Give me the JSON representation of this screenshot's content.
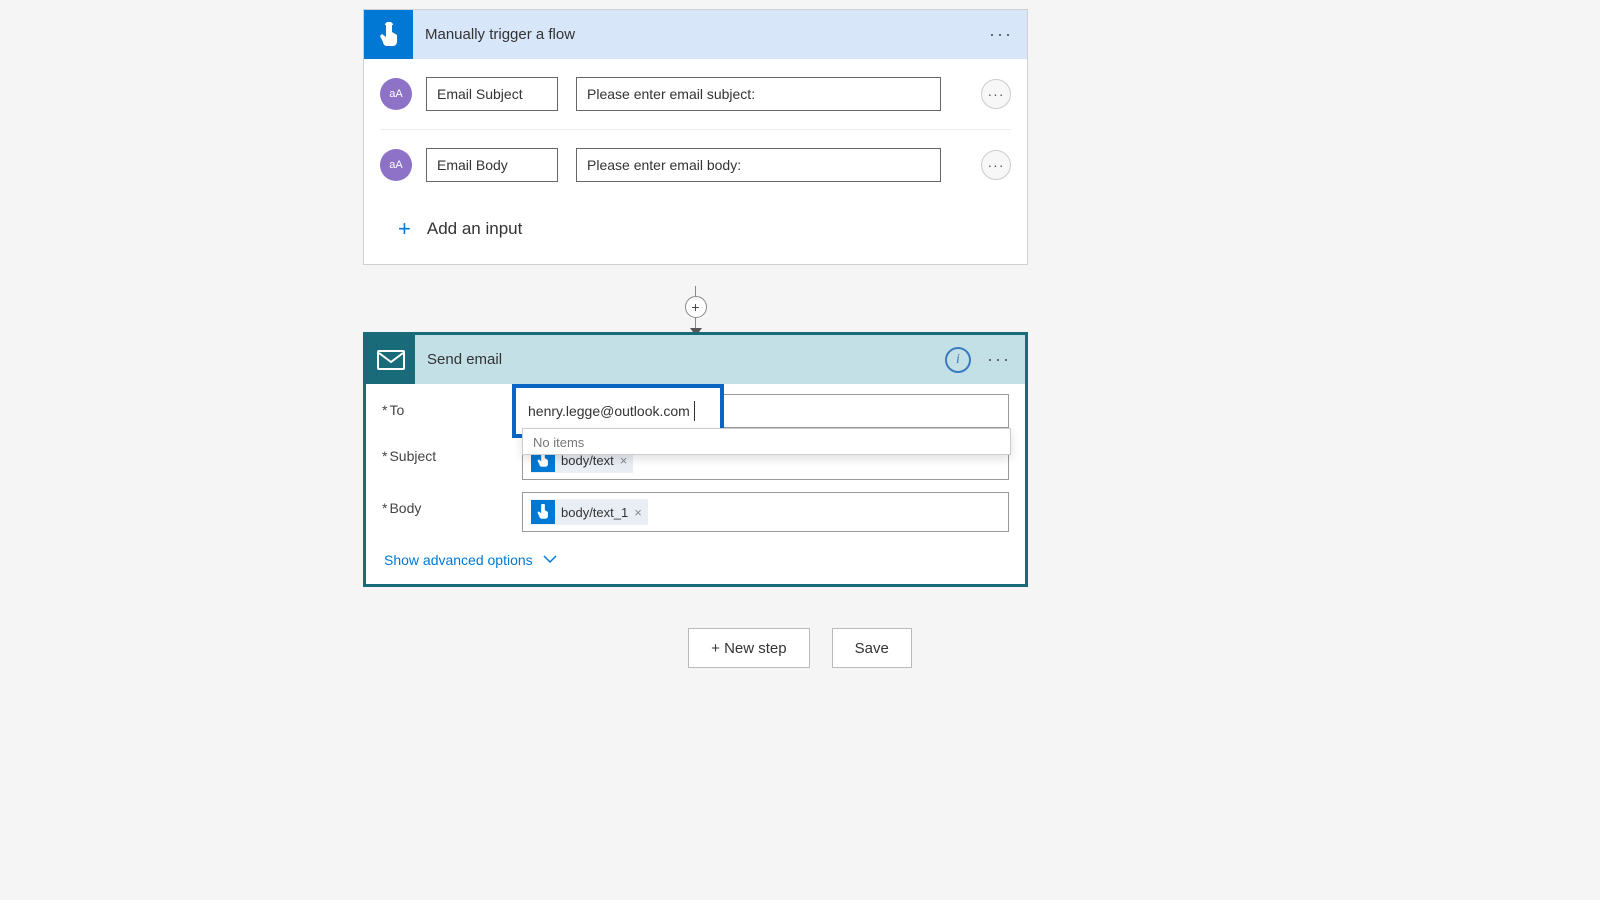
{
  "trigger": {
    "title": "Manually trigger a flow",
    "inputs": [
      {
        "name": "Email Subject",
        "prompt": "Please enter email subject:",
        "typeAbbrev": "aA"
      },
      {
        "name": "Email Body",
        "prompt": "Please enter email body:",
        "typeAbbrev": "aA"
      }
    ],
    "addInputLabel": "Add an input"
  },
  "send": {
    "title": "Send email",
    "fields": {
      "to": {
        "label": "To",
        "value": "henry.legge@outlook.com"
      },
      "subject": {
        "label": "Subject",
        "token": "body/text",
        "tokenShort": "body/text"
      },
      "body": {
        "label": "Body",
        "token": "body/text_1"
      }
    },
    "dropdownNoItems": "No items",
    "advanced": "Show advanced options"
  },
  "footer": {
    "newStep": "+ New step",
    "save": "Save"
  }
}
